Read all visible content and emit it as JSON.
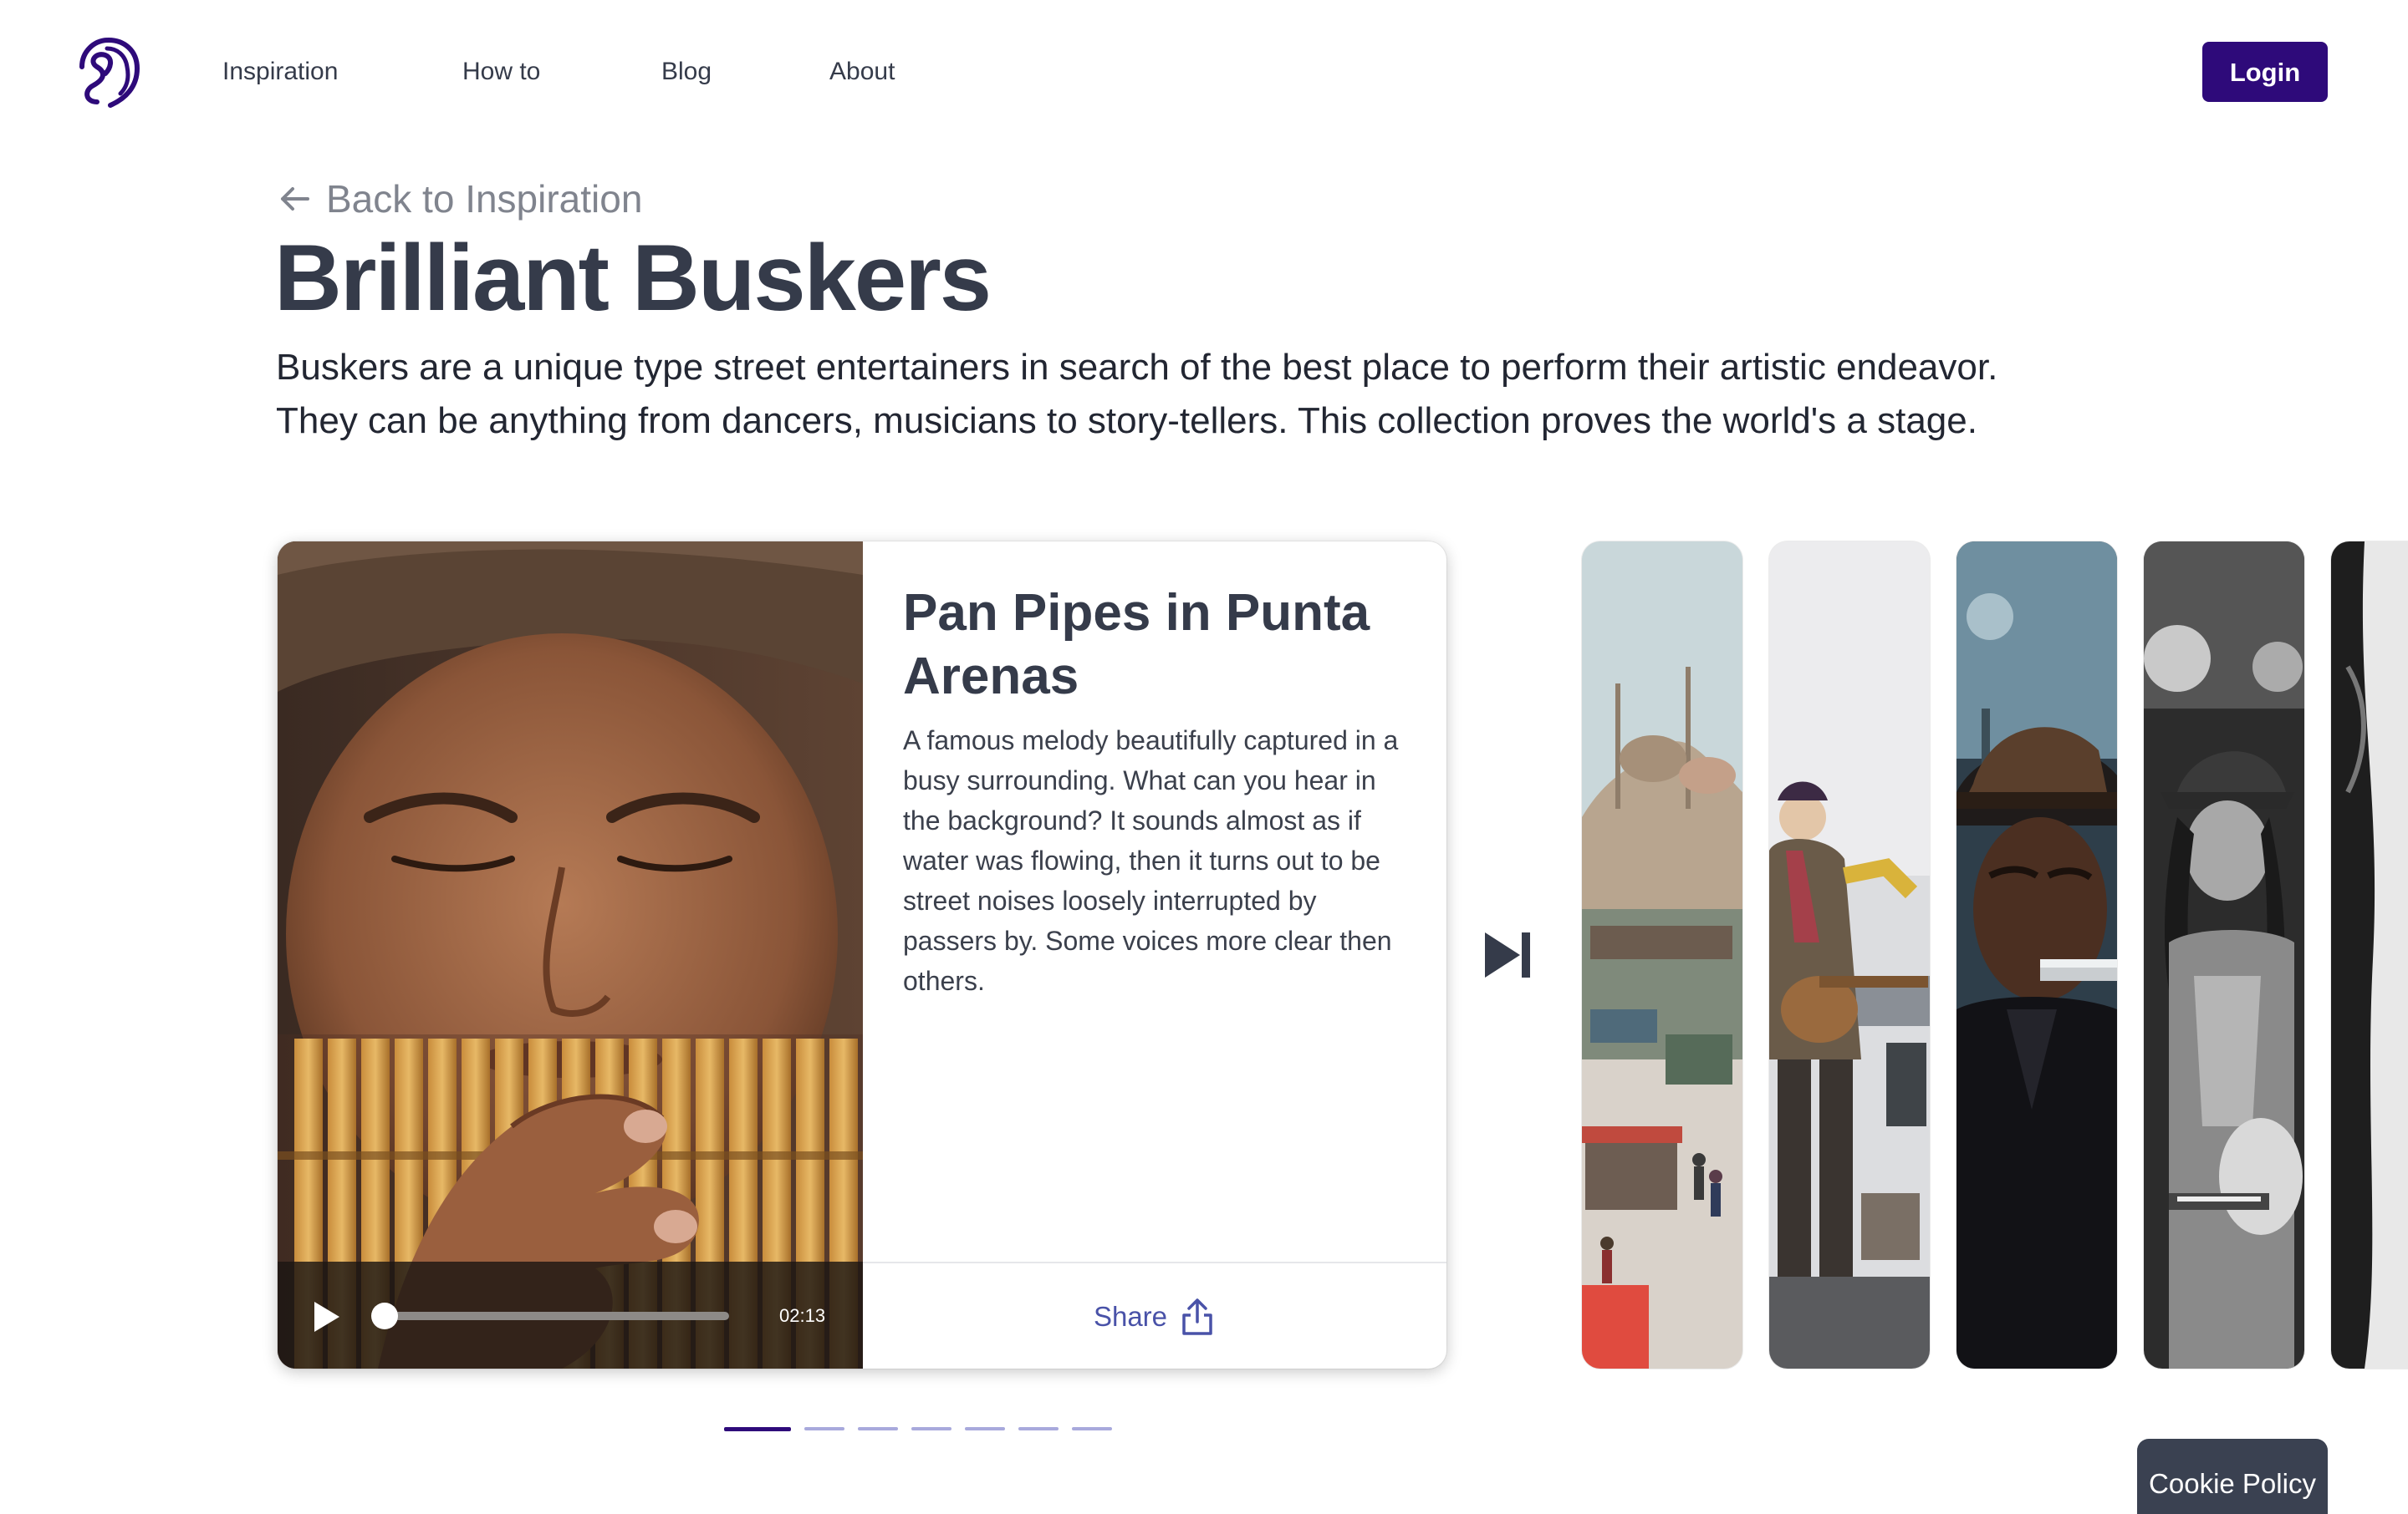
{
  "header": {
    "logo_icon": "ear-icon",
    "nav": [
      {
        "label": "Inspiration"
      },
      {
        "label": "How to"
      },
      {
        "label": "Blog"
      },
      {
        "label": "About"
      }
    ],
    "login_label": "Login",
    "accent_color": "#2e0a7a"
  },
  "hero": {
    "back_label": "Back to Inspiration",
    "title": "Brilliant Buskers",
    "description": "Buskers are a unique type street entertainers in search of the best place to perform their artistic endeavor. They can be anything from dancers, musicians to story-tellers. This collection proves the world's a stage."
  },
  "featured": {
    "title": "Pan Pipes in Punta Arenas",
    "description": "A famous melody beautifully captured in a busy surrounding. What can you hear in the background? It sounds almost as if water was flowing, then it turns out to be street noises loosely interrupted by passers by. Some voices more clear then others.",
    "player": {
      "duration": "02:13",
      "progress": 0.02
    },
    "share_label": "Share",
    "share_color": "#4952a8"
  },
  "pagination": {
    "count": 7,
    "active": 0
  },
  "cookie_label": "Cookie Policy"
}
